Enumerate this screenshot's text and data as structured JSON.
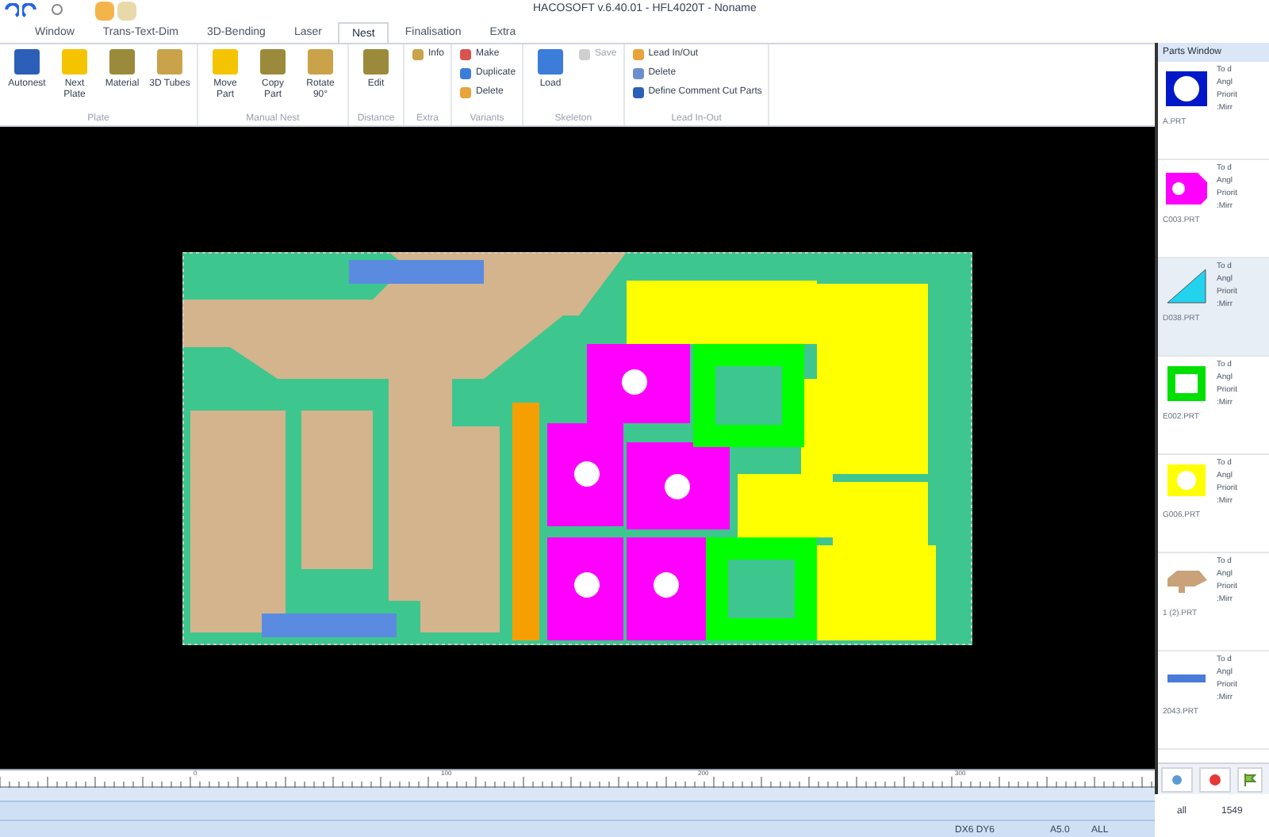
{
  "window": {
    "title": "HACOSOFT v.6.40.01 - HFL4020T - Noname"
  },
  "tabs": [
    {
      "label": "Window",
      "selected": false
    },
    {
      "label": "Trans-Text-Dim",
      "selected": false
    },
    {
      "label": "3D-Bending",
      "selected": false
    },
    {
      "label": "Laser",
      "selected": false
    },
    {
      "label": "Nest",
      "selected": true
    },
    {
      "label": "Finalisation",
      "selected": false
    },
    {
      "label": "Extra",
      "selected": false
    }
  ],
  "ribbon_groups": [
    {
      "label": "Plate",
      "buttons": [
        {
          "label": "Autonest",
          "kind": "large"
        },
        {
          "label": "Next Plate",
          "kind": "large"
        },
        {
          "label": "Material",
          "kind": "large"
        },
        {
          "label": "3D Tubes",
          "kind": "large"
        }
      ]
    },
    {
      "label": "Manual Nest",
      "buttons": [
        {
          "label": "Move Part",
          "kind": "large"
        },
        {
          "label": "Copy Part",
          "kind": "large"
        },
        {
          "label": "Rotate 90°",
          "kind": "large"
        }
      ]
    },
    {
      "label": "Distance",
      "buttons": [
        {
          "label": "Edit",
          "kind": "large"
        }
      ]
    },
    {
      "label": "Extra",
      "buttons": [
        {
          "label": "Info",
          "kind": "small"
        }
      ]
    },
    {
      "label": "Variants",
      "buttons": [
        {
          "label": "Make",
          "kind": "small"
        },
        {
          "label": "Duplicate",
          "kind": "small"
        },
        {
          "label": "Delete",
          "kind": "small"
        }
      ]
    },
    {
      "label": "Skeleton",
      "buttons": [
        {
          "label": "Load",
          "kind": "large"
        },
        {
          "label": "Save",
          "kind": "small",
          "disabled": true
        }
      ]
    },
    {
      "label": "Lead In-Out",
      "buttons": [
        {
          "label": "Lead In/Out",
          "kind": "small"
        },
        {
          "label": "Delete",
          "kind": "small"
        },
        {
          "label": "Define Comment Cut Parts",
          "kind": "small"
        }
      ]
    }
  ],
  "parts_window": {
    "title": "Parts Window",
    "parts": [
      {
        "name": "A.PRT",
        "selected": false,
        "lines": [
          "To d",
          "Angl",
          "Priorit",
          ":Mirr"
        ]
      },
      {
        "name": "C003.PRT",
        "selected": false,
        "lines": [
          "To d",
          "Angl",
          "Priorit",
          ":Mirr"
        ]
      },
      {
        "name": "D038.PRT",
        "selected": true,
        "lines": [
          "To d",
          "Angl",
          "Priorit",
          ":Mirr"
        ]
      },
      {
        "name": "E002.PRT",
        "selected": false,
        "lines": [
          "To d",
          "Angl",
          "Priorit",
          ":Mirr"
        ]
      },
      {
        "name": "G006.PRT",
        "selected": false,
        "lines": [
          "To d",
          "Angl",
          "Priorit",
          ":Mirr"
        ]
      },
      {
        "name": "1 (2).PRT",
        "selected": false,
        "lines": [
          "To d",
          "Angl",
          "Priorit",
          ":Mirr"
        ]
      },
      {
        "name": "2043.PRT",
        "selected": false,
        "lines": [
          "To d",
          "Angl",
          "Priorit",
          ":Mirr"
        ]
      }
    ]
  },
  "ruler": {
    "labels": [
      "0",
      "100",
      "200",
      "300"
    ]
  },
  "status_bar": {
    "row_1": [
      "all",
      "1549"
    ],
    "row_2": [
      "DX6 DY6",
      "A5.0",
      "ALL"
    ]
  }
}
